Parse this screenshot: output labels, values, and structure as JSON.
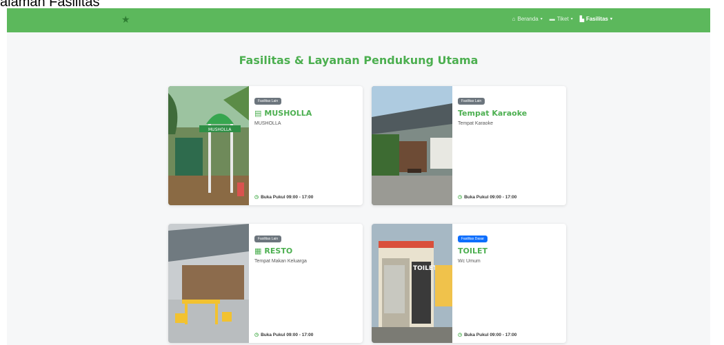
{
  "caption": "alaman Fasilitas",
  "navbar": {
    "brand_icon": "star-icon",
    "items": [
      {
        "label": "Beranda",
        "icon": "home-icon",
        "active": false
      },
      {
        "label": "Tiket",
        "icon": "ticket-icon",
        "active": false
      },
      {
        "label": "Fasilitas",
        "icon": "building-icon",
        "active": true
      }
    ],
    "accent_color": "#5cb85c"
  },
  "page": {
    "title": "Fasilitas & Layanan Pendukung Utama"
  },
  "cards": [
    {
      "badge": "Fasilitas Lain",
      "badge_color": "#6c757d",
      "title": "MUSHOLLA",
      "icon": "building-icon",
      "description": "MUSHOLLA",
      "hours": "Buka Pukul 09:00 - 17:00"
    },
    {
      "badge": "Fasilitas Lain",
      "badge_color": "#6c757d",
      "title": "Tempat Karaoke",
      "icon": "",
      "description": "Tempat Karaoke",
      "hours": "Buka Pukul 09:00 - 17:00"
    },
    {
      "badge": "Fasilitas Lain",
      "badge_color": "#6c757d",
      "title": "RESTO",
      "icon": "shop-icon",
      "description": "Tempat Makan Keluarga",
      "hours": "Buka Pukul 09:00 - 17:00"
    },
    {
      "badge": "Fasilitas Dasar",
      "badge_color": "#0d6efd",
      "title": "TOILET",
      "icon": "",
      "description": "Wc Umum",
      "hours": "Buka Pukul 09:00 - 17:00"
    }
  ]
}
